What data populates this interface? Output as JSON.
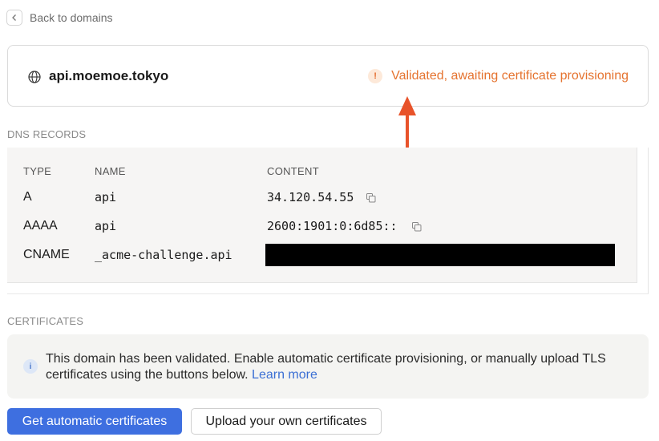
{
  "nav": {
    "back_label": "Back to domains"
  },
  "domain": {
    "name": "api.moemoe.tokyo",
    "status_icon": "!",
    "status_text": "Validated, awaiting certificate provisioning",
    "status_color": "#e5732f"
  },
  "dns": {
    "section_label": "DNS RECORDS",
    "columns": [
      "TYPE",
      "NAME",
      "CONTENT"
    ],
    "rows": [
      {
        "type": "A",
        "name": "api",
        "content": "34.120.54.55"
      },
      {
        "type": "AAAA",
        "name": "api",
        "content": "2600:1901:0:6d85::"
      },
      {
        "type": "CNAME",
        "name": "_acme-challenge.api",
        "content": ""
      }
    ]
  },
  "certificates": {
    "section_label": "CERTIFICATES",
    "info_icon": "i",
    "message": "This domain has been validated. Enable automatic certificate provisioning, or manually upload TLS certificates using the buttons below.",
    "learn_more": "Learn more",
    "primary_button": "Get automatic certificates",
    "secondary_button": "Upload your own certificates"
  },
  "colors": {
    "accent": "#3e6fe0",
    "warning": "#e5732f",
    "annotation_arrow": "#e8532a"
  }
}
